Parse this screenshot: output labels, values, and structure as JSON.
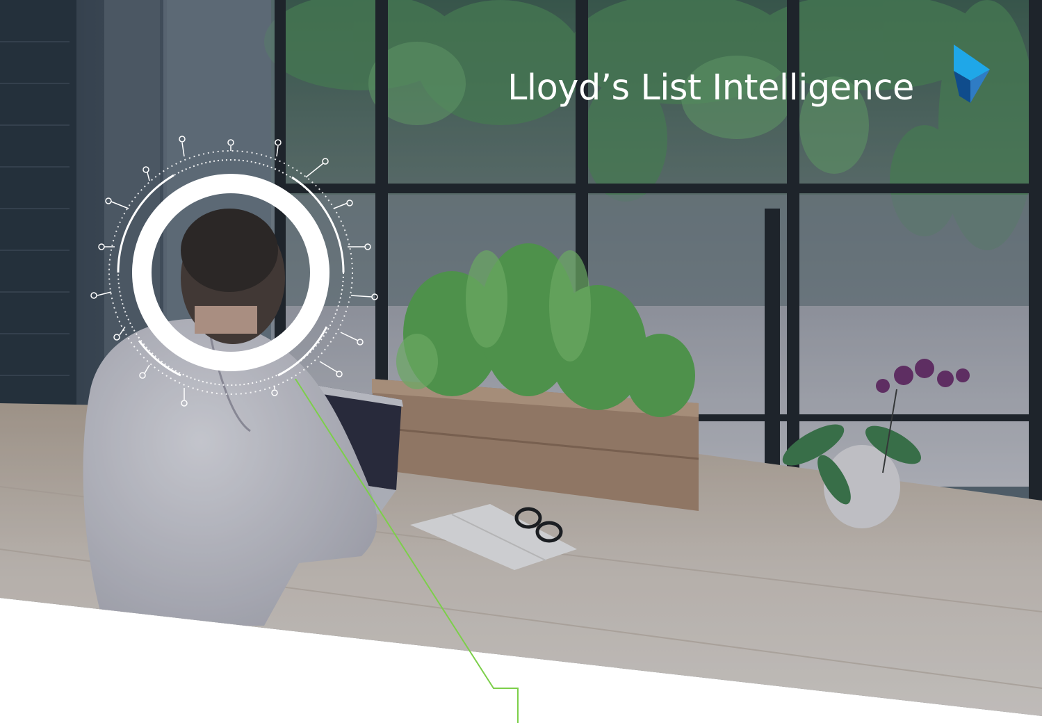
{
  "brand": {
    "name": "Lloyd’s List Intelligence",
    "mark_icon": "lli-play-mark-icon",
    "colors": {
      "mark_light": "#1fa7e8",
      "mark_dark": "#0f4c8c",
      "mark_mid": "#2f7cc4",
      "accent_line": "#7ccf4a",
      "text": "#ffffff"
    }
  },
  "scene": {
    "icons": [
      "radial-dial-icon",
      "connector-line-icon"
    ]
  }
}
